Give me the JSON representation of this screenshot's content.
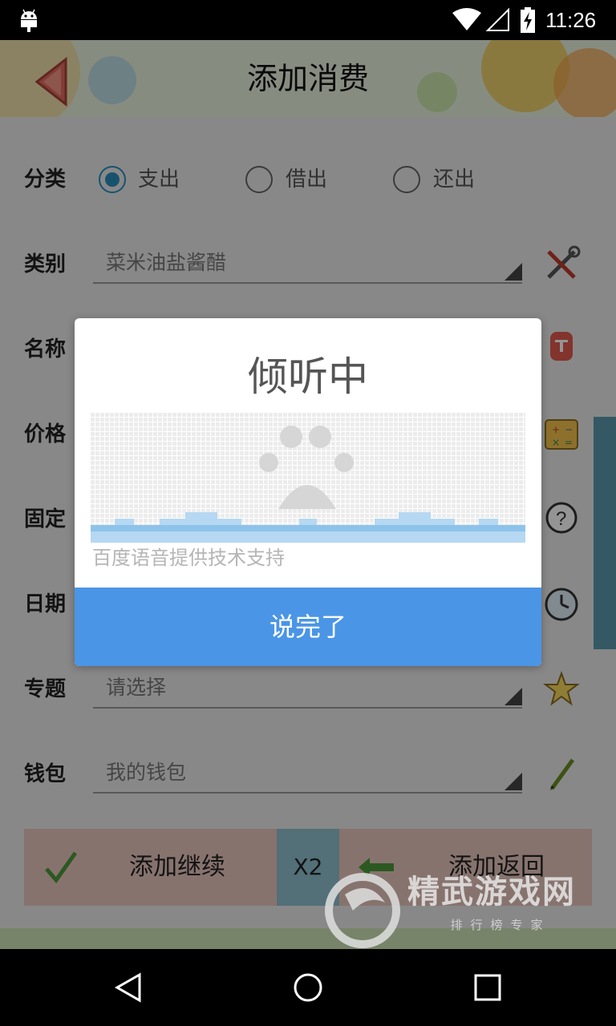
{
  "status_bar": {
    "time": "11:26",
    "icons": [
      "android-icon",
      "wifi-icon",
      "signal-icon",
      "battery-charging-icon"
    ]
  },
  "header": {
    "title": "添加消费",
    "back_icon": "back-arrow-icon"
  },
  "form": {
    "classification": {
      "label": "分类",
      "options": [
        {
          "label": "支出",
          "checked": true
        },
        {
          "label": "借出",
          "checked": false
        },
        {
          "label": "还出",
          "checked": false
        }
      ]
    },
    "category": {
      "label": "类别",
      "value": "菜米油盐酱醋",
      "icon": "tools-icon"
    },
    "name": {
      "label": "名称",
      "icon": "tag-icon"
    },
    "price": {
      "label": "价格",
      "icon": "calculator-icon"
    },
    "fixed": {
      "label": "固定",
      "icon": "question-icon"
    },
    "date": {
      "label": "日期",
      "icon": "clock-icon"
    },
    "topic": {
      "label": "专题",
      "value": "请选择",
      "icon": "star-icon"
    },
    "wallet": {
      "label": "钱包",
      "value": "我的钱包",
      "icon": "pencil-icon"
    }
  },
  "buttons": {
    "continue_label": "添加继续",
    "x2_label": "X2",
    "return_label": "添加返回"
  },
  "dialog": {
    "title": "倾听中",
    "provider": "百度语音提供技术支持",
    "done_label": "说完了"
  },
  "watermark": {
    "title": "精武游戏网",
    "subtitle": "排行榜专家"
  },
  "colors": {
    "accent": "#2a8fbd",
    "dialog_button": "#4a95e6",
    "button_bg": "#e8c7bd",
    "x2_bg": "#8fbfcf"
  }
}
